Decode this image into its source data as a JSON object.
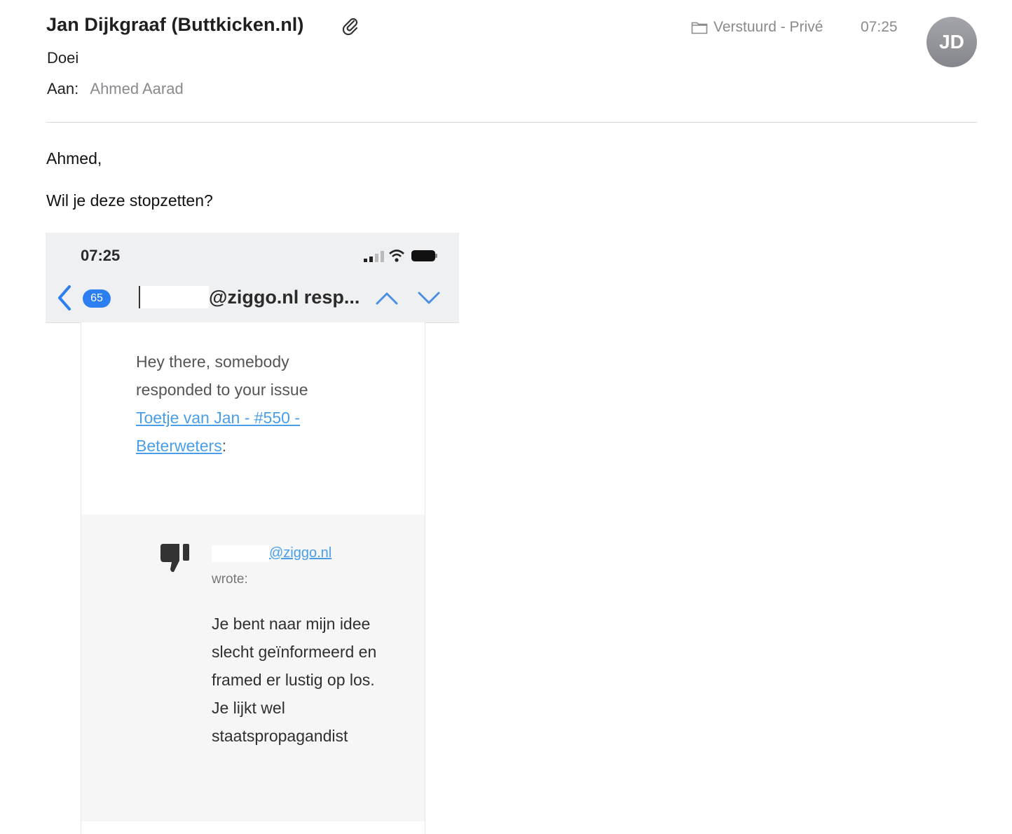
{
  "header": {
    "sender": "Jan Dijkgraaf (Buttkicken.nl)",
    "subject": "Doei",
    "to_label": "Aan:",
    "to_value": "Ahmed Aarad",
    "folder": "Verstuurd - Privé",
    "time": "07:25",
    "avatar_initials": "JD",
    "icons": {
      "attachment": "paperclip-icon",
      "folder": "folder-icon"
    }
  },
  "body": {
    "greeting": "Ahmed,",
    "line": "Wil je deze stopzetten?"
  },
  "screenshot": {
    "status_time": "07:25",
    "badge_count": "65",
    "nav_subject": "@ziggo.nl resp...",
    "notice_text": "Hey there, somebody responded to your issue",
    "issue_link": "Toetje van Jan - #550 - Beterweters",
    "notice_suffix": ":",
    "author_link": "@ziggo.nl",
    "wrote": "wrote:",
    "quote": "Je bent naar mijn idee slecht geïnformeerd en framed er lustig op los. Je lijkt wel staatspropagandist"
  },
  "colors": {
    "link": "#4a9ee8",
    "badge": "#2c7ff0",
    "avatar": "#95969c",
    "muted": "#8a8a8e"
  }
}
